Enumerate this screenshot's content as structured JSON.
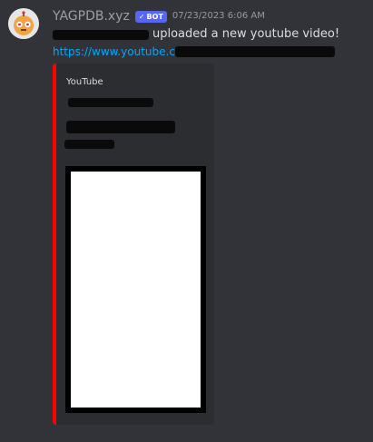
{
  "message": {
    "author": {
      "username": "YAGPDB.xyz",
      "badge_label": "BOT",
      "badge_check": "✓",
      "avatar_icon": "robot-icon"
    },
    "timestamp": "07/23/2023 6:06 AM",
    "content_text": "uploaded a new youtube video!",
    "link_text": "https://www.youtube.c"
  },
  "embed": {
    "provider": "YouTube",
    "accent_color": "#ff0000"
  },
  "colors": {
    "background": "#313338",
    "embed_background": "#2b2d31",
    "bot_badge": "#5865f2",
    "link": "#00a8fc"
  }
}
